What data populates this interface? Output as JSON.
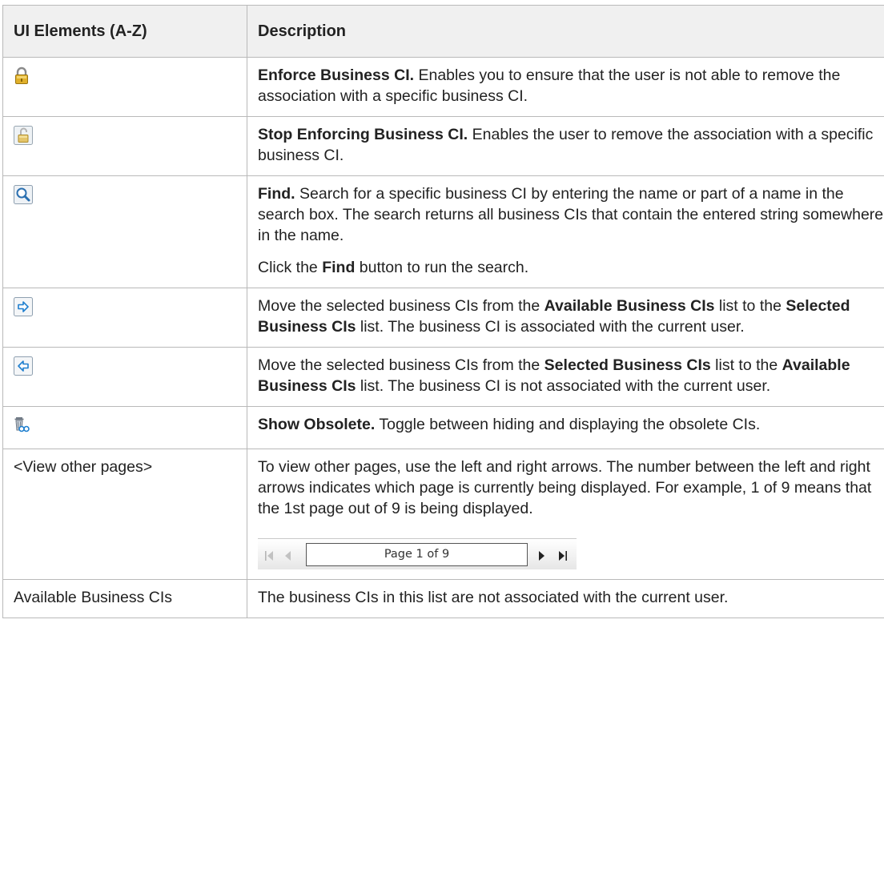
{
  "table": {
    "headers": [
      "UI Elements (A-Z)",
      "Description"
    ],
    "rows": [
      {
        "icon": "lock-icon",
        "title": "Enforce Business CI.",
        "text": " Enables you to ensure that the user is not able to remove the association with a specific business CI."
      },
      {
        "icon": "unlock-icon",
        "title": "Stop Enforcing Business CI.",
        "text": " Enables the user to remove the association with a specific business CI."
      },
      {
        "icon": "magnifier-icon",
        "title": "Find.",
        "text": " Search for a specific business CI by entering the name or part of a name in the search box. The search returns all business CIs that contain the entered string somewhere in the name.",
        "note_pre": "Click the ",
        "note_bold": "Find",
        "note_post": " button to run the search."
      },
      {
        "icon": "arrow-right-icon",
        "p1": "Move the selected business CIs from the ",
        "b1": "Available Business CIs",
        "p2": " list to the ",
        "b2": "Selected Business CIs",
        "p3": " list. The business CI is associated with the current user."
      },
      {
        "icon": "arrow-left-icon",
        "p1": "Move the selected business CIs from the ",
        "b1": "Selected Business CIs",
        "p2": " list to the ",
        "b2": "Available Business CIs",
        "p3": " list. The business CI is not associated with the current user."
      },
      {
        "icon": "show-obsolete-icon",
        "title": "Show Obsolete.",
        "text": " Toggle between hiding and displaying the obsolete CIs."
      },
      {
        "element": "<View other pages>",
        "text": "To view other pages, use the left and right arrows. The number between the left and right arrows indicates which page is currently being displayed. For example, 1 of 9 means that the 1st page out of 9 is being displayed.",
        "pager": {
          "label": "Page 1 of 9",
          "icons": [
            "first-page-icon",
            "previous-page-icon",
            "next-page-icon",
            "last-page-icon"
          ]
        }
      },
      {
        "element": "Available Business CIs",
        "text": "The business CIs in this list are not associated with the current user."
      }
    ]
  },
  "colors": {
    "border": "#b9b9b9",
    "header_background": "#f0f0f0",
    "text": "#222222",
    "lock_gold": "#d2a019",
    "button_blue": "#1f7fcf"
  }
}
